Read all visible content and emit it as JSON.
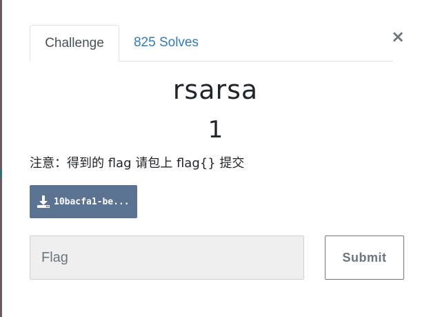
{
  "tabs": {
    "challenge_label": "Challenge",
    "solves_label": "825 Solves"
  },
  "close_icon": "close-icon",
  "challenge": {
    "name": "rsarsa",
    "value": "1",
    "description": "注意：得到的 flag 请包上 flag{} 提交"
  },
  "file": {
    "label": "10bacfa1-be...",
    "icon": "download-icon"
  },
  "submission": {
    "placeholder": "Flag",
    "value": "",
    "submit_label": "Submit"
  },
  "colors": {
    "tab_link": "#337ab7",
    "file_button_bg": "#5b7290",
    "input_bg": "#efefef",
    "submit_border": "#6c757d"
  }
}
